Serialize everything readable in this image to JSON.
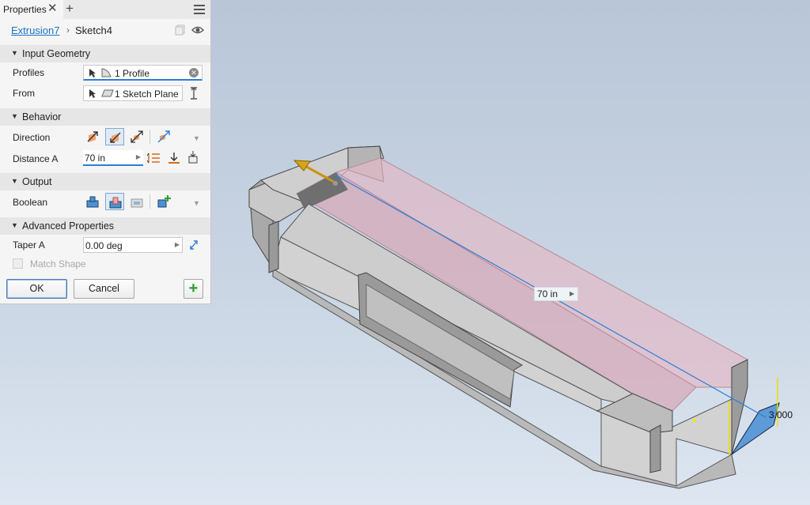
{
  "panel": {
    "tab_title": "Properties",
    "close_symbol": "✕",
    "add_symbol": "+",
    "breadcrumb": {
      "feature": "Extrusion7",
      "separator": "›",
      "sketch": "Sketch4"
    },
    "sections": {
      "input_geometry": "Input Geometry",
      "behavior": "Behavior",
      "output": "Output",
      "advanced": "Advanced Properties"
    },
    "rows": {
      "profiles_label": "Profiles",
      "profiles_value": "1 Profile",
      "from_label": "From",
      "from_value": "1 Sketch Plane",
      "direction_label": "Direction",
      "distance_label": "Distance A",
      "distance_value": "70 in",
      "boolean_label": "Boolean",
      "taper_label": "Taper A",
      "taper_value": "0.00 deg",
      "match_shape_label": "Match Shape"
    },
    "buttons": {
      "ok": "OK",
      "cancel": "Cancel",
      "plus": "+"
    }
  },
  "viewport": {
    "distance_dim": "70 in",
    "dim_arrow": "▶",
    "side_dim": "3.000"
  },
  "colors": {
    "accent": "#2a7fd4",
    "selected_fill": "#dfeaf6",
    "preview_fill": "#e8b8c8",
    "model_gray": "#c8c8c8"
  },
  "icons": [
    "pointer-icon",
    "profile-icon",
    "sketch-plane-icon",
    "flip-icon",
    "direction-default-icon",
    "direction-flipped-icon",
    "direction-symmetric-icon",
    "direction-asymmetric-icon",
    "distance-icon",
    "to-next-icon",
    "to-icon",
    "join-icon",
    "cut-icon",
    "intersect-icon",
    "new-solid-icon",
    "taper-flip-icon",
    "visibility-icon",
    "copy-icon",
    "menu-icon"
  ]
}
